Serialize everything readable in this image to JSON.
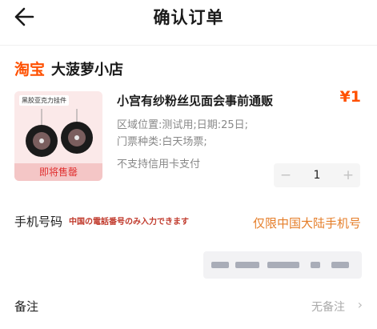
{
  "header": {
    "title": "确认订单"
  },
  "shop": {
    "platform": "淘宝",
    "name": "大菠萝小店"
  },
  "product": {
    "title": "小宫有纱粉丝见面会事前通贩",
    "price": "¥1",
    "spec_line1": "区域位置:测试用;日期:25日;",
    "spec_line2": "门票种类:白天场票;",
    "payment_note": "不支持信用卡支付",
    "thumbnail_caption": "黑胶亚克力挂件",
    "thumbnail_badge": "即将售罄",
    "quantity": "1",
    "minus": "−",
    "plus": "+"
  },
  "phone": {
    "label": "手机号码",
    "note_jp": "中国の電話番号のみ入力できます",
    "hint": "仅限中国大陆手机号"
  },
  "remark": {
    "label": "备注",
    "value": "无备注",
    "chevron": "›"
  },
  "colors": {
    "accent": "#ff5000",
    "hint": "#e57d28",
    "note": "#c0392b"
  }
}
